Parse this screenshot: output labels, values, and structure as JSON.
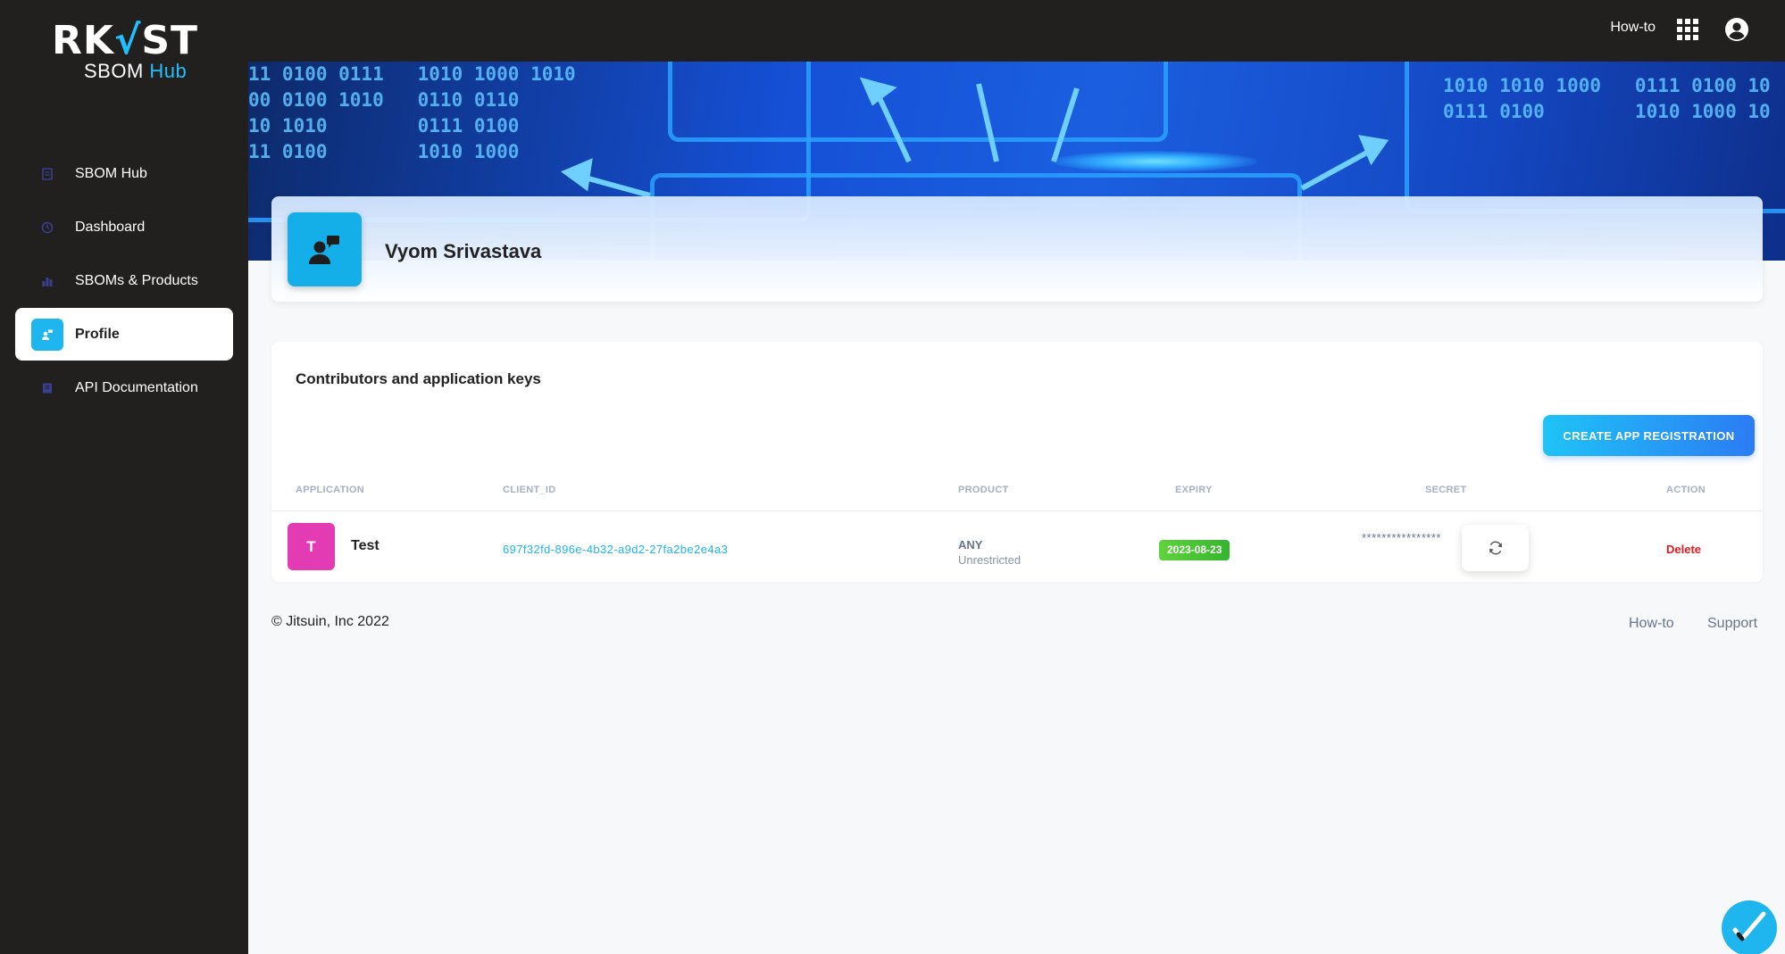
{
  "brand": {
    "wordmark_left": "RK",
    "wordmark_check": "√",
    "wordmark_right": "ST",
    "product_prefix": "SBOM",
    "product_suffix": "Hub",
    "accent_color": "#1ec0ff"
  },
  "topbar": {
    "howto_label": "How-to",
    "apps_icon": "grid-icon",
    "account_icon": "account-circle-icon"
  },
  "sidebar": {
    "items": [
      {
        "label": "SBOM Hub",
        "icon": "hub-icon",
        "active": false
      },
      {
        "label": "Dashboard",
        "icon": "clock-icon",
        "active": false
      },
      {
        "label": "SBOMs & Products",
        "icon": "chart-icon",
        "active": false
      },
      {
        "label": "Profile",
        "icon": "profile-icon",
        "active": true
      },
      {
        "label": "API Documentation",
        "icon": "book-icon",
        "active": false
      }
    ]
  },
  "banner": {
    "binary_left": "11 0100 0111   1010 1000 1010\n00 0100 1010   0110 0110\n10 1010        0111 0100\n11 0100        1010 1000",
    "binary_right": "1010 1010 1000   0111 0100 10\n0111 0100        1010 1000 10"
  },
  "profile": {
    "name": "Vyom Srivastava"
  },
  "keys": {
    "title": "Contributors and application keys",
    "create_label": "CREATE APP REGISTRATION",
    "columns": {
      "application": "APPLICATION",
      "client_id": "CLIENT_ID",
      "product": "PRODUCT",
      "expiry": "EXPIRY",
      "secret": "SECRET",
      "action": "ACTION"
    },
    "rows": [
      {
        "avatar_letter": "T",
        "avatar_color": "#e33bb3",
        "name": "Test",
        "client_id": "697f32fd-896e-4b32-a9d2-27fa2be2e4a3",
        "product": "ANY",
        "product_scope": "Unrestricted",
        "expiry": "2023-08-23",
        "secret": "****************",
        "action": "Delete"
      }
    ]
  },
  "footer": {
    "copyright": "© Jitsuin, Inc  2022",
    "links": [
      "How-to",
      "Support"
    ]
  }
}
